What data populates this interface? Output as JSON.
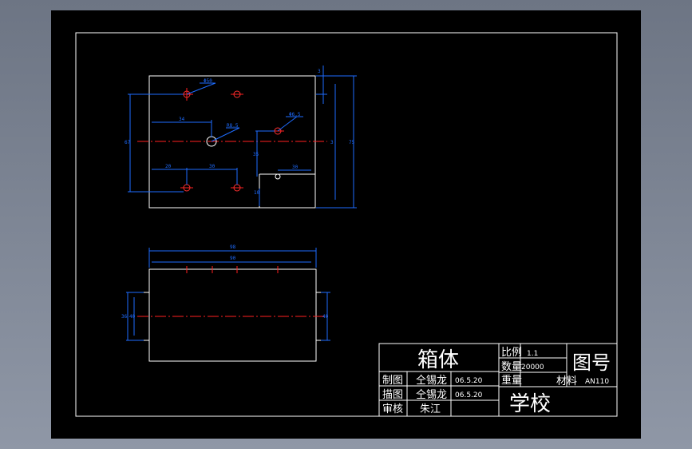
{
  "colors": {
    "background": "#000000",
    "frame": "#ffffff",
    "dimension": "#1e6cff",
    "centerline": "#ff2020",
    "hole": "#ff3030"
  },
  "top_view": {
    "dims": {
      "hole_dia": "Φ50",
      "offset_34": "34",
      "radius": "R8.5",
      "dia_right": "Φ6.5",
      "height_left": "67",
      "height_mid": "35",
      "small_top": "3",
      "height_right": "75",
      "small_right": "3",
      "width_20": "20",
      "width_30": "30",
      "width_right": "30",
      "small_bottom": "10"
    }
  },
  "front_view": {
    "dims": {
      "overall": "98",
      "inner": "90",
      "left_a": "36",
      "left_b": "40",
      "right_a": "40"
    }
  },
  "title_block": {
    "part_name": "箱体",
    "scale_label": "比例",
    "scale_value": "1.1",
    "qty_label": "数量",
    "qty_value": "20000",
    "weight_label": "重量",
    "drawing_no_label": "图号",
    "material_label": "材料",
    "material_value": "AN110",
    "row1_role": "制图",
    "row1_name": "仝锡龙",
    "row1_date": "06.5.20",
    "row2_role": "描图",
    "row2_name": "仝锡龙",
    "row2_date": "06.5.20",
    "row3_role": "审核",
    "row3_name": "朱江",
    "school": "学校"
  }
}
